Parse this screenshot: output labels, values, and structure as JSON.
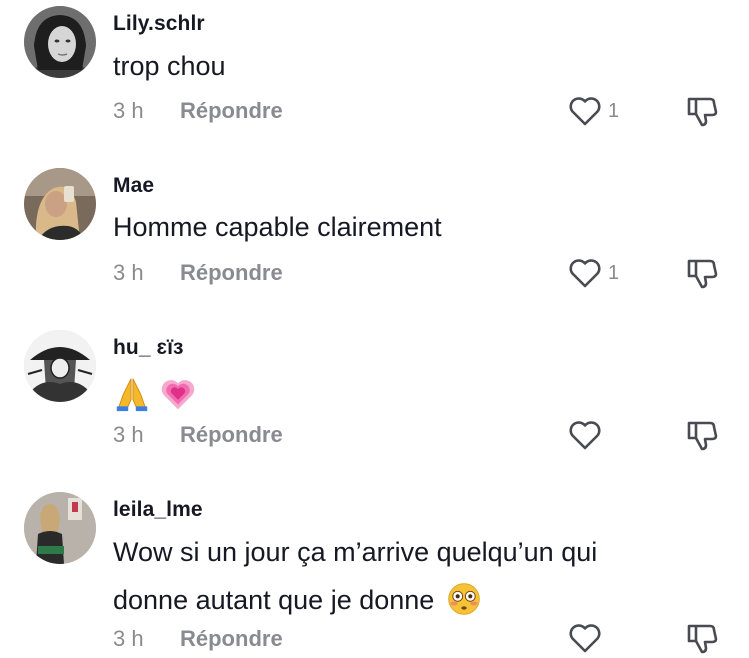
{
  "colors": {
    "text": "#161823",
    "muted": "#8a8b91",
    "icon": "#4a4b52"
  },
  "comments": [
    {
      "username": "Lily.schlr",
      "text": "trop chou",
      "time": "3 h",
      "reply_label": "Répondre",
      "likes": "1"
    },
    {
      "username": "Mae",
      "text": "Homme capable clairement",
      "time": "3 h",
      "reply_label": "Répondre",
      "likes": "1"
    },
    {
      "username": "hu_ ɛïɜ",
      "text": "",
      "emojis": [
        "folded-hands-emoji",
        "growing-heart-emoji"
      ],
      "time": "3 h",
      "reply_label": "Répondre",
      "likes": ""
    },
    {
      "username": "leila_lme",
      "text_line1": "Wow si un jour ça m’arrive quelqu’un qui",
      "text_line2": "donne autant que je donne",
      "emoji_end": "flushed-face-emoji",
      "time": "3 h",
      "reply_label": "Répondre",
      "likes": ""
    }
  ]
}
